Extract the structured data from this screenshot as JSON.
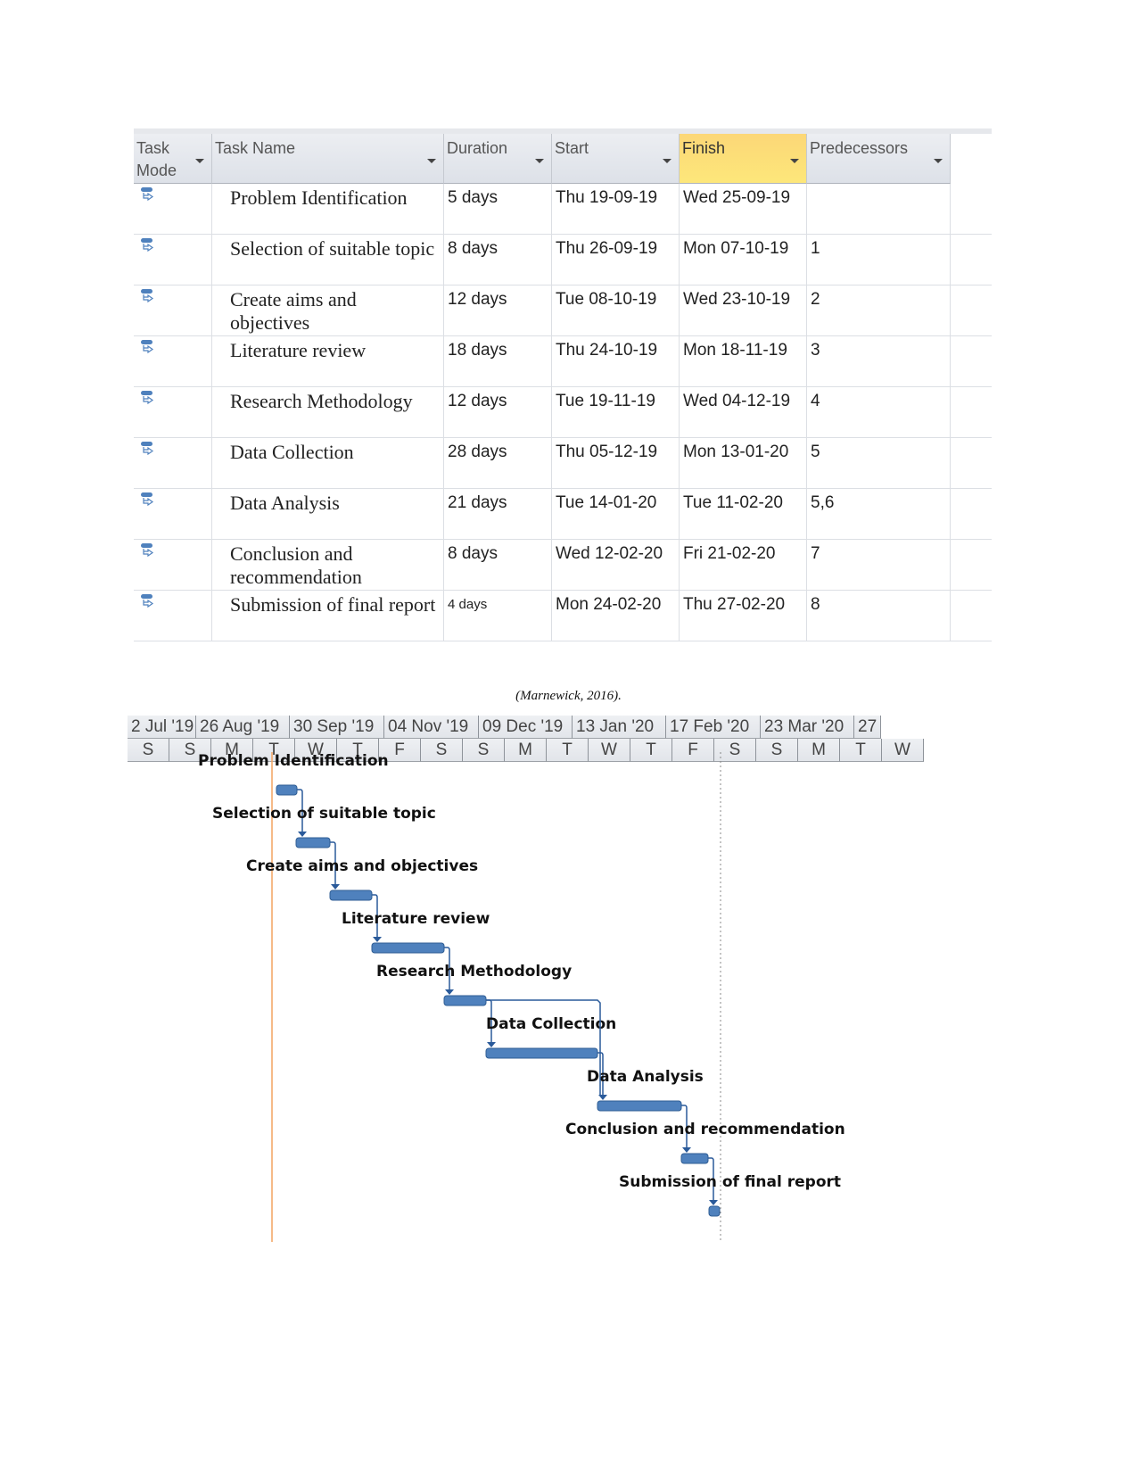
{
  "table": {
    "columns": [
      {
        "label": "Task Mode",
        "selected": false
      },
      {
        "label": "Task Name",
        "selected": false
      },
      {
        "label": "Duration",
        "selected": false
      },
      {
        "label": "Start",
        "selected": false
      },
      {
        "label": "Finish",
        "selected": true
      },
      {
        "label": "Predecessors",
        "selected": false
      }
    ],
    "rows": [
      {
        "mode_icon": "auto-scheduled-task-icon",
        "name": "Problem Identification",
        "duration": "5 days",
        "start": "Thu 19-09-19",
        "finish": "Wed 25-09-19",
        "predecessors": ""
      },
      {
        "mode_icon": "auto-scheduled-task-icon",
        "name": "Selection of suitable topic",
        "duration": "8 days",
        "start": "Thu 26-09-19",
        "finish": "Mon 07-10-19",
        "predecessors": "1"
      },
      {
        "mode_icon": "auto-scheduled-task-icon",
        "name": "Create aims and objectives",
        "duration": "12 days",
        "start": "Tue 08-10-19",
        "finish": "Wed 23-10-19",
        "predecessors": "2"
      },
      {
        "mode_icon": "auto-scheduled-task-icon",
        "name": "Literature review",
        "duration": "18 days",
        "start": "Thu 24-10-19",
        "finish": "Mon 18-11-19",
        "predecessors": "3"
      },
      {
        "mode_icon": "auto-scheduled-task-icon",
        "name": "Research Methodology",
        "duration": "12 days",
        "start": "Tue 19-11-19",
        "finish": "Wed 04-12-19",
        "predecessors": "4"
      },
      {
        "mode_icon": "auto-scheduled-task-icon",
        "name": "Data Collection",
        "duration": "28 days",
        "start": "Thu 05-12-19",
        "finish": "Mon 13-01-20",
        "predecessors": "5"
      },
      {
        "mode_icon": "auto-scheduled-task-icon",
        "name": "Data Analysis",
        "duration": "21 days",
        "start": "Tue 14-01-20",
        "finish": "Tue 11-02-20",
        "predecessors": "5,6"
      },
      {
        "mode_icon": "auto-scheduled-task-icon",
        "name": "Conclusion and recommendation",
        "duration": "8 days",
        "start": "Wed 12-02-20",
        "finish": "Fri 21-02-20",
        "predecessors": "7"
      },
      {
        "mode_icon": "auto-scheduled-task-icon",
        "name": "Submission of final report",
        "duration": "4 days",
        "start": "Mon 24-02-20",
        "finish": "Thu 27-02-20",
        "predecessors": "8"
      }
    ]
  },
  "caption": "(Marnewick, 2016).",
  "timeline": {
    "top_tier": [
      "2 Jul '19",
      "26 Aug '19",
      "30 Sep '19",
      "04 Nov '19",
      "09 Dec '19",
      "13 Jan '20",
      "17 Feb '20",
      "23 Mar '20",
      "27"
    ],
    "bottom_tier": [
      "S",
      "S",
      "M",
      "T",
      "W",
      "T",
      "F",
      "S",
      "S",
      "M",
      "T",
      "W",
      "T",
      "F",
      "S",
      "S",
      "M",
      "T",
      "W"
    ]
  },
  "gantt": {
    "bar_color": "#4f81bd",
    "link_color": "#2a5a9a",
    "today_line_color": "#f4a460",
    "task_labels": [
      "Problem Identification",
      "Selection of suitable topic",
      "Create aims and objectives",
      "Literature review",
      "Research Methodology",
      "Data Collection",
      "Data Analysis",
      "Conclusion and recommendation",
      "Submission of final report"
    ]
  }
}
